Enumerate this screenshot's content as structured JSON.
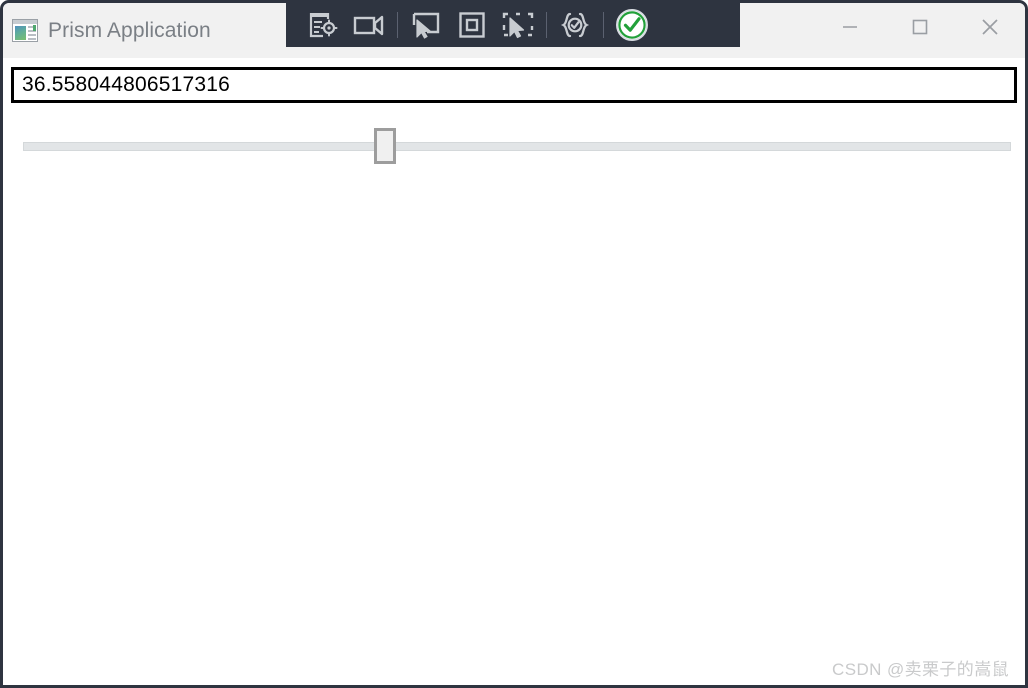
{
  "window": {
    "title": "Prism Application",
    "app_icon": "window-panels-icon",
    "border_color": "#2e3440",
    "titlebar_color": "#f1f1f1",
    "client_color": "#ffffff"
  },
  "inspector_toolbar": {
    "background_color": "#2e3440",
    "icon_color": "#c8ccd1",
    "accent_color": "#22a03a",
    "buttons": [
      {
        "name": "inspect-properties-icon",
        "label": "Inspect Element Properties"
      },
      {
        "name": "record-video-icon",
        "label": "Record"
      },
      {
        "name": "hover-mode-icon",
        "label": "Hover Mode"
      },
      {
        "name": "focus-element-icon",
        "label": "Focus Element"
      },
      {
        "name": "select-element-icon",
        "label": "Select Element"
      },
      {
        "name": "code-validate-icon",
        "label": "Validate Code"
      },
      {
        "name": "status-ok-icon",
        "label": "Connected"
      }
    ]
  },
  "window_controls": [
    {
      "name": "minimize-button",
      "glyph": "minimize-icon"
    },
    {
      "name": "maximize-button",
      "glyph": "maximize-icon"
    },
    {
      "name": "close-button",
      "glyph": "close-icon"
    }
  ],
  "client": {
    "textbox": {
      "value": "36.558044806517316",
      "placeholder": ""
    },
    "slider": {
      "value": 36.558044806517316,
      "min": 0,
      "max": 100,
      "thumb_percent": 36.6
    }
  },
  "watermark": {
    "text": "CSDN @卖栗子的嵩鼠"
  }
}
